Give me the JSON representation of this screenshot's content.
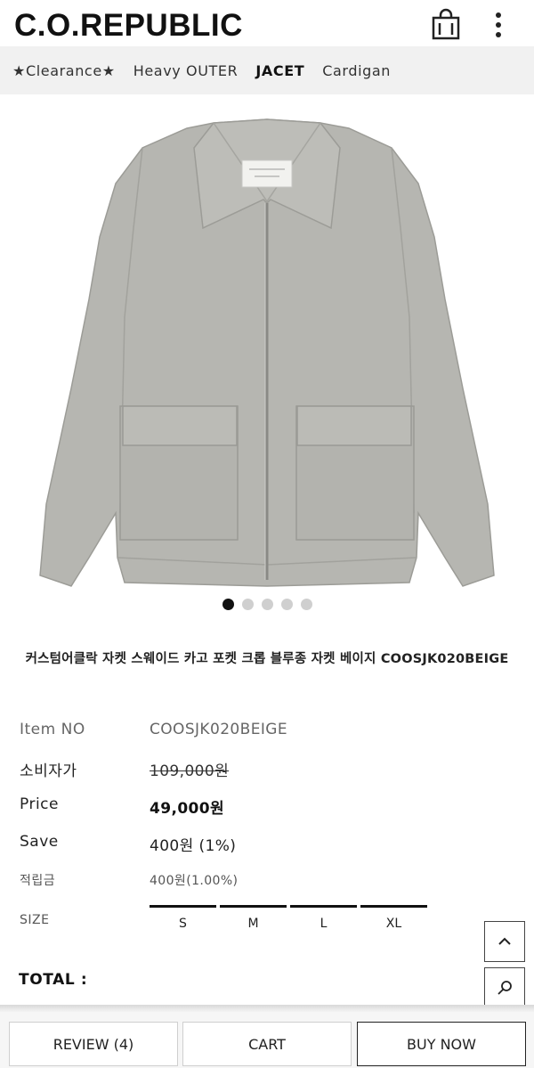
{
  "header": {
    "logo": "C.O.REPUBLIC",
    "bag_icon": "shopping-bag-icon",
    "more_icon": "more-vertical-icon"
  },
  "categories": [
    {
      "label": "★Clearance★"
    },
    {
      "label": "Heavy OUTER"
    },
    {
      "label": "JACET",
      "active": true
    },
    {
      "label": "Cardigan"
    }
  ],
  "product": {
    "image_icon": "jacket-image",
    "image_count": 5,
    "active_image_index": 0,
    "title": "커스텀어클락 자켓 스웨이드 카고 포켓 크롭 블루종 자켓 베이지 COOSJK020BEIGE",
    "item_no_label": "Item NO",
    "item_no": "COOSJK020BEIGE",
    "msrp_label": "소비자가",
    "msrp": "109,000원",
    "price_label": "Price",
    "price": "49,000원",
    "save_label": "Save",
    "save": "400원 (1%)",
    "points_label": "적립금",
    "points": "400원(1.00%)",
    "size_label": "SIZE",
    "sizes": [
      "S",
      "M",
      "L",
      "XL"
    ],
    "total_label": "TOTAL :"
  },
  "floating": {
    "up_icon": "chevron-up-icon",
    "search_icon": "search-icon"
  },
  "bottom_bar": {
    "review": "REVIEW (4)",
    "cart": "CART",
    "buy_now": "BUY NOW"
  },
  "colors": {
    "accent": "#111111",
    "nav_bg": "#f1f1f1",
    "jacket": "#b5b5b0"
  }
}
